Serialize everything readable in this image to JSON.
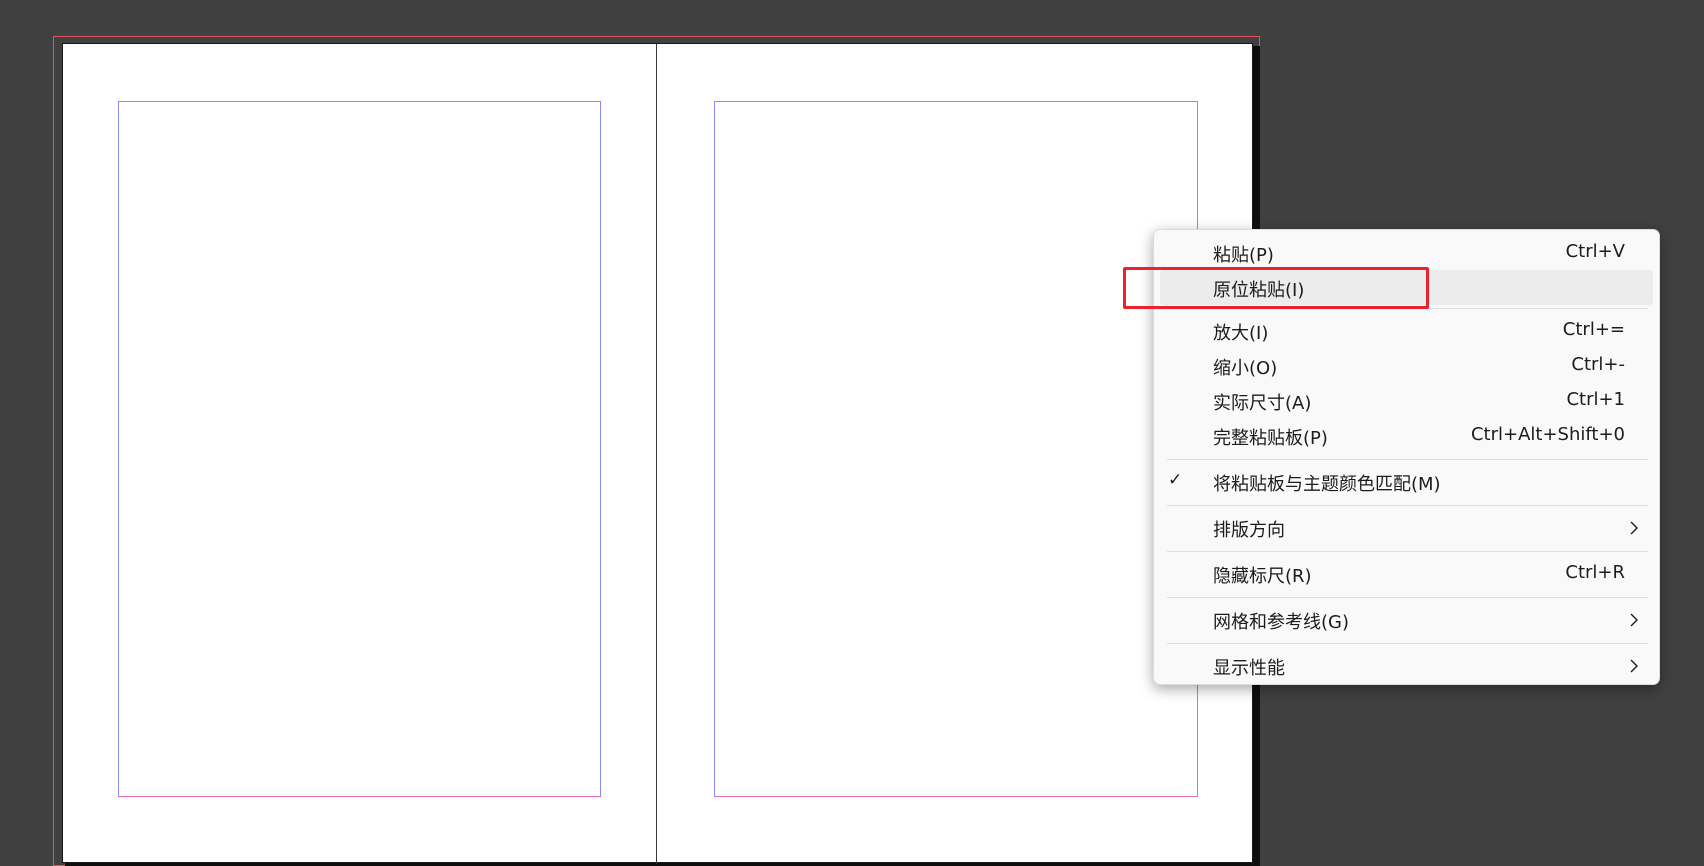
{
  "document": {
    "background_color": "#404040",
    "page_color": "#ffffff",
    "bleed_guide_color": "#e2525c",
    "margin_guide_color": "#8e8cf5"
  },
  "context_menu": {
    "items": [
      {
        "label": "粘贴(P)",
        "shortcut": "Ctrl+V",
        "checked": false,
        "submenu": false
      },
      {
        "label": "原位粘贴(I)",
        "shortcut": "",
        "checked": false,
        "submenu": false,
        "highlighted": true
      },
      {
        "label": "放大(I)",
        "shortcut": "Ctrl+=",
        "checked": false,
        "submenu": false
      },
      {
        "label": "缩小(O)",
        "shortcut": "Ctrl+-",
        "checked": false,
        "submenu": false
      },
      {
        "label": "实际尺寸(A)",
        "shortcut": "Ctrl+1",
        "checked": false,
        "submenu": false
      },
      {
        "label": "完整粘贴板(P)",
        "shortcut": "Ctrl+Alt+Shift+0",
        "checked": false,
        "submenu": false
      },
      {
        "label": "将粘贴板与主题颜色匹配(M)",
        "shortcut": "",
        "checked": true,
        "submenu": false
      },
      {
        "label": "排版方向",
        "shortcut": "",
        "checked": false,
        "submenu": true
      },
      {
        "label": "隐藏标尺(R)",
        "shortcut": "Ctrl+R",
        "checked": false,
        "submenu": false
      },
      {
        "label": "网格和参考线(G)",
        "shortcut": "",
        "checked": false,
        "submenu": true
      },
      {
        "label": "显示性能",
        "shortcut": "",
        "checked": false,
        "submenu": true
      }
    ],
    "check_glyph": "✓",
    "highlight_color": "#e8232b"
  }
}
